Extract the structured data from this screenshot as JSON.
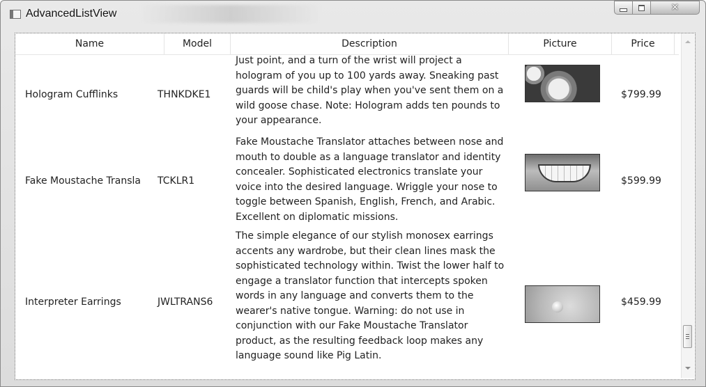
{
  "window": {
    "title": "AdvancedListView",
    "background_title_ghost": "",
    "accent": "#f4f4f4"
  },
  "caption_buttons": {
    "minimize_icon": "minimize-icon",
    "maximize_icon": "maximize-icon",
    "close_icon": "close-icon",
    "close_glyph": "✕"
  },
  "list": {
    "columns": [
      "Name",
      "Model",
      "Description",
      "Picture",
      "Price"
    ],
    "rows": [
      {
        "name": "Hologram Cufflinks",
        "model": "THNKDKE1",
        "description": "Just point, and a turn of the wrist will project a hologram of you up to 100 yards away. Sneaking past guards will be child's play when you've sent them on a wild goose chase. Note: Hologram adds ten pounds to your appearance.",
        "picture": "cufflinks-image",
        "price": "$799.99"
      },
      {
        "name": "Fake Moustache Transla",
        "model": "TCKLR1",
        "description": "Fake Moustache Translator attaches between nose and mouth to double as a language translator and identity concealer. Sophisticated electronics translate your voice into the desired language. Wriggle your nose to toggle between Spanish, English, French, and Arabic. Excellent on diplomatic missions.",
        "picture": "moustache-smile-image",
        "price": "$599.99"
      },
      {
        "name": "Interpreter Earrings",
        "model": "JWLTRANS6",
        "description": "The simple elegance of our stylish monosex earrings accents any wardrobe, but their clean lines mask the sophisticated technology within. Twist the lower half to engage a translator function that intercepts spoken words in any language and converts them to the wearer's native tongue. Warning: do not use in conjunction with our Fake Moustache Translator product, as the resulting feedback loop makes any language sound like Pig Latin.",
        "picture": "earring-image",
        "price": "$459.99"
      }
    ]
  },
  "scrollbar": {
    "up_icon": "scroll-up-arrow-icon",
    "down_icon": "scroll-down-arrow-icon",
    "position_fraction": 0.95
  }
}
